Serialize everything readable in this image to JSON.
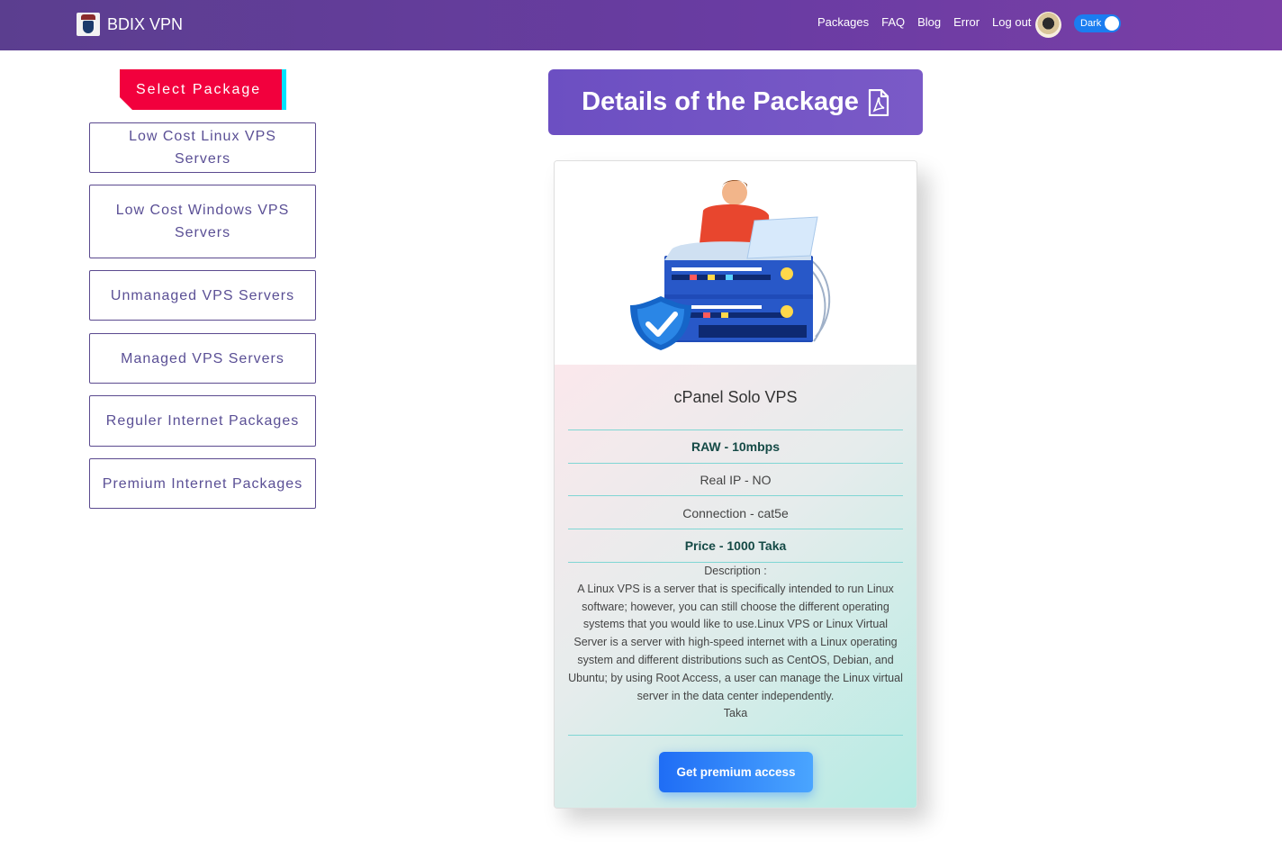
{
  "brand": {
    "name": "BDIX VPN",
    "logo_text": "VPN"
  },
  "nav": {
    "links": [
      "Packages",
      "FAQ",
      "Blog",
      "Error",
      "Log out"
    ],
    "theme_toggle_label": "Dark",
    "theme_toggle_on": true
  },
  "sidebar": {
    "title": "Select Package",
    "packages": [
      "Low Cost Linux VPS Servers",
      "Low Cost Windows VPS Servers",
      "Unmanaged VPS Servers",
      "Managed VPS Servers",
      "Reguler Internet Packages",
      "Premium Internet Packages"
    ]
  },
  "details": {
    "title": "Details of the Package",
    "pdf_icon": "pdf-file-icon"
  },
  "card": {
    "name": "cPanel Solo VPS",
    "raw": "RAW - 10mbps",
    "real_ip": "Real IP - NO",
    "connection": "Connection - cat5e",
    "price": "Price - 1000 Taka",
    "description_label": "Description :",
    "description": "A Linux VPS is a server that is specifically intended to run Linux software; however, you can still choose the different operating systems that you would like to use.Linux VPS or Linux Virtual Server is a server with high-speed internet with a Linux operating system and different distributions such as CentOS, Debian, and Ubuntu; by using Root Access, a user can manage the Linux virtual server in the data center independently.",
    "description_suffix": "Taka",
    "cta": "Get premium access"
  },
  "colors": {
    "navbar": "#6a3ca3",
    "select_title": "#f2003d",
    "select_accent": "#00e4ff",
    "header": "#7158c4",
    "cta": "#2a7cf8"
  }
}
